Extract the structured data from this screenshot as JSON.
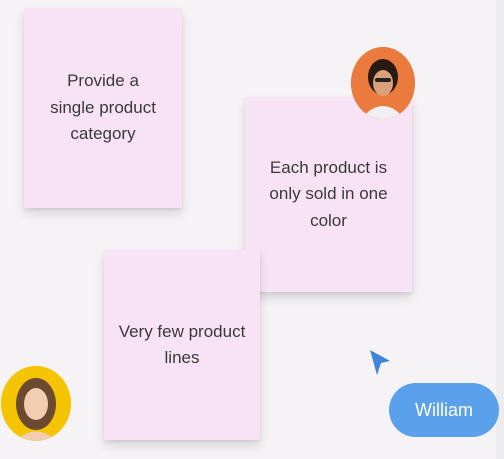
{
  "notes": [
    {
      "text": "Provide a single product category"
    },
    {
      "text": "Each product is only sold in one color"
    },
    {
      "text": "Very few product lines"
    }
  ],
  "collaborator": {
    "name": "William"
  },
  "icons": {
    "cursor": "cursor-arrow-icon",
    "avatar_top": "avatar-icon",
    "avatar_bottom": "avatar-icon"
  },
  "colors": {
    "note": "#f7e3f5",
    "pill": "#5aa0ea",
    "cursor": "#3f86d8",
    "avatar_top_bg": "#ea7a3d",
    "avatar_bottom_bg": "#f5c400"
  }
}
